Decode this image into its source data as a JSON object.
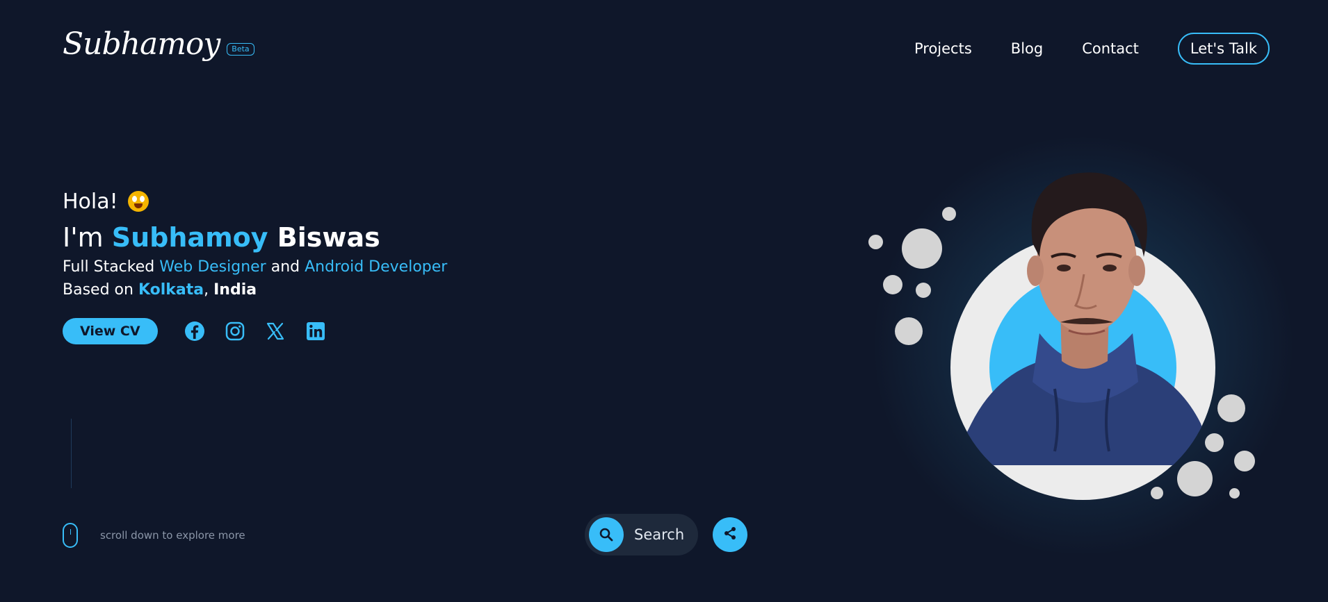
{
  "brand": {
    "name": "Subhamoy",
    "badge": "Beta"
  },
  "nav": {
    "projects": "Projects",
    "blog": "Blog",
    "contact": "Contact",
    "cta": "Let's Talk"
  },
  "hero": {
    "greeting": "Hola!",
    "greeting_emoji": "grinning-emoji",
    "name_prefix": "I'm ",
    "first_name": "Subhamoy",
    "last_name": "Biswas",
    "role_prefix": "Full Stacked ",
    "role_1": "Web Designer",
    "role_join": " and ",
    "role_2": "Android Developer",
    "location_prefix": "Based on ",
    "city": "Kolkata",
    "location_sep": ", ",
    "country": "India",
    "cv_label": "View CV"
  },
  "social": [
    "facebook-icon",
    "instagram-icon",
    "x-icon",
    "linkedin-icon"
  ],
  "scroll_hint": "scroll down to explore more",
  "search": {
    "label": "Search"
  },
  "colors": {
    "background": "#0f172a",
    "accent": "#38bdf8",
    "text": "#ffffff",
    "muted": "#8b96a8"
  }
}
